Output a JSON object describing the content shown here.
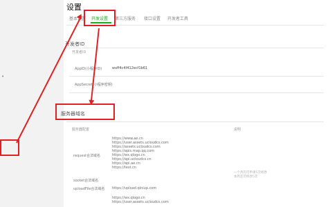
{
  "page": {
    "title": "设置",
    "tabs": [
      "基本设置",
      "开发设置",
      "第三方服务",
      "接口设置",
      "开发者工具"
    ],
    "active_tab_index": 1
  },
  "developer_id": {
    "section_title": "开发者ID",
    "table_header": "开发者ID",
    "rows": [
      {
        "label": "AppID(小程序ID)",
        "value": "wxff4c4f412ecf1b61"
      },
      {
        "label": "AppSecret(小程序密钥)",
        "value": ""
      }
    ]
  },
  "server_domain": {
    "section_title": "服务器域名",
    "header_left": "服务器配置",
    "header_right": "说明",
    "request": {
      "label": "request合法域名",
      "domains": [
        "https://www.ae.cn",
        "https://user.assets.ucloudcs.com",
        "https://assets.ucloudcs.com",
        "https://apis.map.qq.com",
        "https://wx.qlogo.cn",
        "https://api.ucloudcs.cn",
        "https://api.ae.cn",
        "https://test.cn"
      ]
    },
    "socket": {
      "label": "socket合法域名"
    },
    "uploadFile": {
      "label": "uploadFile合法域名",
      "domains": [
        "https://upload.qiniup.com"
      ]
    },
    "downloadFile": {
      "domains": [
        "https://wx.qlogo.cn",
        "https://user.assets.ucloudcs.com"
      ]
    },
    "hint_lines": [
      "一个月内可申请5次修改",
      "本月还可修改5次"
    ]
  },
  "annotation_colors": {
    "highlight": "#e02020",
    "accent": "#1aad19"
  }
}
